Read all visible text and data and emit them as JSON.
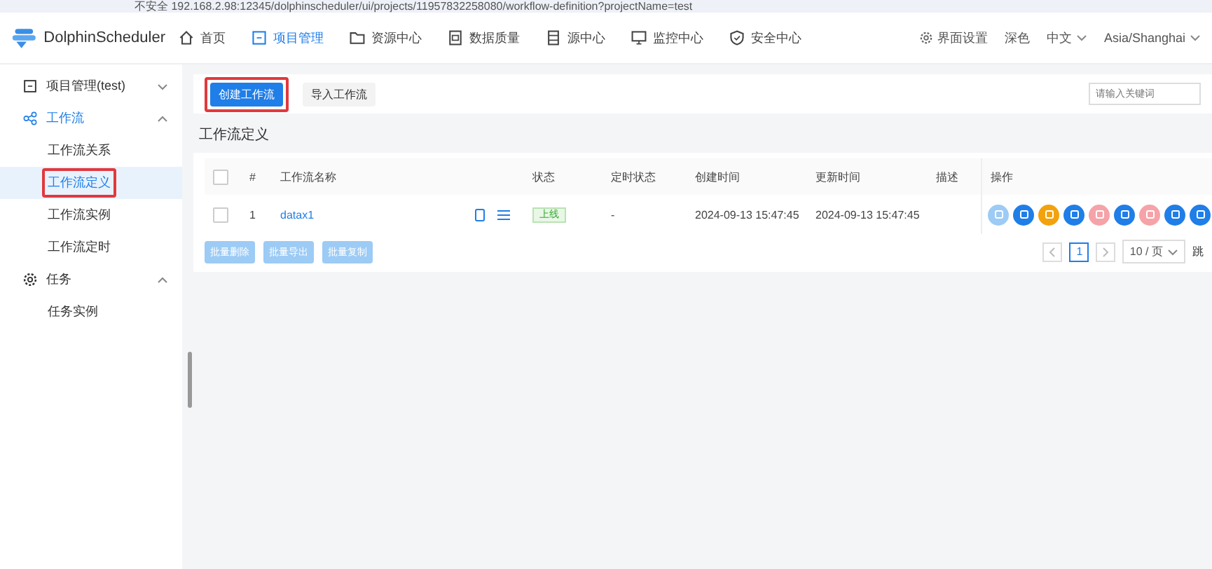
{
  "browser": {
    "address": "不安全  192.168.2.98:12345/dolphinscheduler/ui/projects/11957832258080/workflow-definition?projectName=test"
  },
  "header": {
    "logo": "DolphinScheduler",
    "nav": [
      {
        "label": "首页",
        "kind": "home",
        "selected": false
      },
      {
        "label": "项目管理",
        "kind": "project",
        "selected": true
      },
      {
        "label": "资源中心",
        "kind": "folder",
        "selected": false
      },
      {
        "label": "数据质量",
        "kind": "quality",
        "selected": false
      },
      {
        "label": "源中心",
        "kind": "datasource",
        "selected": false
      },
      {
        "label": "监控中心",
        "kind": "monitor",
        "selected": false
      },
      {
        "label": "安全中心",
        "kind": "shield",
        "selected": false
      }
    ],
    "settings": "界面设置",
    "theme": "深色",
    "language": "中文",
    "timezone": "Asia/Shanghai"
  },
  "sidebar": {
    "items": [
      {
        "label": "项目管理(test)",
        "kind": "project",
        "expanded": false,
        "selected": false
      },
      {
        "label": "工作流",
        "kind": "flow",
        "expanded": true,
        "selected": true,
        "children": [
          {
            "label": "工作流关系",
            "selected": false,
            "highlighted": false
          },
          {
            "label": "工作流定义",
            "selected": true,
            "highlighted": true
          },
          {
            "label": "工作流实例",
            "selected": false,
            "highlighted": false
          },
          {
            "label": "工作流定时",
            "selected": false,
            "highlighted": false
          }
        ]
      },
      {
        "label": "任务",
        "kind": "gear",
        "expanded": true,
        "selected": false,
        "children": [
          {
            "label": "任务实例",
            "selected": false,
            "highlighted": false
          }
        ]
      }
    ]
  },
  "toolbar": {
    "buttons": [
      {
        "label": "创建工作流",
        "kind": "primary",
        "highlighted": true
      },
      {
        "label": "导入工作流",
        "kind": "default",
        "highlighted": false
      }
    ],
    "search": {
      "placeholder": "请输入关键词"
    }
  },
  "section_title": "工作流定义",
  "table": {
    "all_checked": false,
    "columns": [
      "#",
      "工作流名称",
      "状态",
      "定时状态",
      "创建时间",
      "更新时间",
      "描述",
      "操作"
    ],
    "rows": [
      {
        "checked": false,
        "index": "1",
        "name": "datax1",
        "status": "上线",
        "schedule_status": "-",
        "created": "2024-09-13 15:47:45",
        "updated": "2024-09-13 15:47:45",
        "actions": [
          {
            "color": "#9ccbf5"
          },
          {
            "color": "#1f7ee8"
          },
          {
            "color": "#f2a20c"
          },
          {
            "color": "#1f7ee8"
          },
          {
            "color": "#f5a3a8"
          },
          {
            "color": "#1f7ee8"
          },
          {
            "color": "#f5a3a8"
          },
          {
            "color": "#1f7ee8"
          },
          {
            "color": "#1f7ee8"
          }
        ]
      }
    ],
    "batch_buttons": [
      {
        "label": "批量删除",
        "disabled": true
      },
      {
        "label": "批量导出",
        "disabled": true
      },
      {
        "label": "批量复制",
        "disabled": true
      }
    ],
    "pagination": {
      "pages": [
        {
          "label": "1",
          "selected": true
        }
      ],
      "page_size": "10 / 页",
      "jump": "跳"
    }
  }
}
